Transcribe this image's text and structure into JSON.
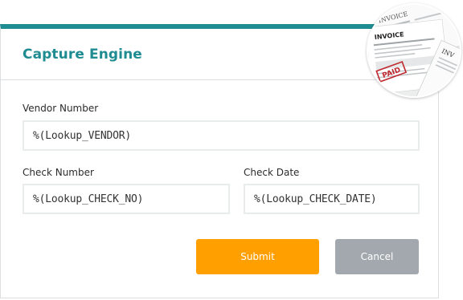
{
  "header": {
    "title": "Capture Engine"
  },
  "form": {
    "vendor_number": {
      "label": "Vendor Number",
      "value": "%(Lookup_VENDOR)"
    },
    "check_number": {
      "label": "Check Number",
      "value": "%(Lookup_CHECK_NO)"
    },
    "check_date": {
      "label": "Check Date",
      "value": "%(Lookup_CHECK_DATE)"
    }
  },
  "actions": {
    "submit_label": "Submit",
    "cancel_label": "Cancel"
  },
  "badge": {
    "words": [
      "INVOICE",
      "INVOICE",
      "PAID",
      "INV"
    ]
  },
  "colors": {
    "accent": "#1e8c91",
    "submit": "#ff9f00",
    "cancel": "#a2a8ad",
    "paid_stamp": "#c0282f"
  }
}
